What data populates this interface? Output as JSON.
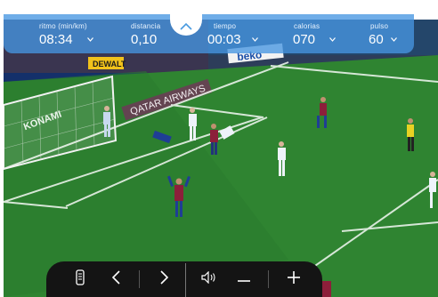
{
  "metrics": [
    {
      "label": "ritmo (min/km)",
      "value": "08:34",
      "chevron": "chevron-down-icon"
    },
    {
      "label": "distancia",
      "value": "0,10",
      "chevron": "chevron-down-icon"
    },
    {
      "label": "tiempo",
      "value": "00:03",
      "chevron": "chevron-down-icon"
    },
    {
      "label": "calorias",
      "value": "070",
      "chevron": "chevron-down-icon"
    },
    {
      "label": "pulso",
      "value": "60",
      "chevron": "chevron-down-icon"
    }
  ],
  "collapse": {
    "icon": "chevron-up-icon"
  },
  "video": {
    "ads": [
      "DEWALT",
      "QATAR AIRWAYS",
      "beko",
      "KONAMI"
    ]
  },
  "controls": {
    "icons": [
      "remote-icon",
      "chevron-left-icon",
      "chevron-right-icon",
      "speaker-icon",
      "minus-icon",
      "plus-icon"
    ]
  },
  "colors": {
    "bar": "#4696e1",
    "pitch": "#2f7f2f",
    "controls_bg": "#141414"
  }
}
